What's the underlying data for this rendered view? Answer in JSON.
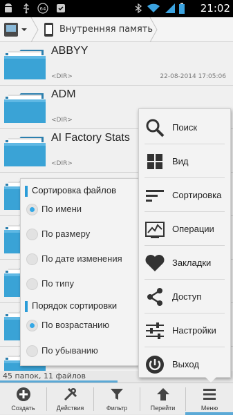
{
  "status_bar": {
    "time": "21:02",
    "icons": [
      "android-icon",
      "usb-icon",
      "notification-64-icon",
      "clean-master-icon",
      "bluetooth-icon",
      "wifi-icon",
      "signal-icon",
      "battery-icon"
    ]
  },
  "path_bar": {
    "drive_icon": "sd-card-icon",
    "location": "Внутренняя память"
  },
  "files": [
    {
      "name": "ABBYY",
      "type": "<DIR>",
      "date": "22-08-2014 17:05:06"
    },
    {
      "name": "ADM",
      "type": "<DIR>",
      "date": ""
    },
    {
      "name": "AI Factory Stats",
      "type": "<DIR>",
      "date": ""
    },
    {
      "name": "",
      "type": "",
      "date": ""
    },
    {
      "name": "",
      "type": "",
      "date": ""
    },
    {
      "name": "",
      "type": "",
      "date": ""
    },
    {
      "name": "",
      "type": "",
      "date": ""
    },
    {
      "name": "",
      "type": "",
      "date": ""
    }
  ],
  "count_text": "45 папок, 11 файлов",
  "sort_popup": {
    "section_files": "Сортировка файлов",
    "file_options": [
      {
        "label": "По имени",
        "selected": true
      },
      {
        "label": "По размеру",
        "selected": false
      },
      {
        "label": "По дате изменения",
        "selected": false
      },
      {
        "label": "По типу",
        "selected": false
      }
    ],
    "section_order": "Порядок сортировки",
    "order_options": [
      {
        "label": "По возрастанию",
        "selected": true
      },
      {
        "label": "По убыванию",
        "selected": false
      }
    ]
  },
  "menu": [
    {
      "label": "Поиск",
      "icon": "search-icon"
    },
    {
      "label": "Вид",
      "icon": "grid-view-icon"
    },
    {
      "label": "Сортировка",
      "icon": "sort-icon"
    },
    {
      "label": "Операции",
      "icon": "operations-chart-icon"
    },
    {
      "label": "Закладки",
      "icon": "heart-icon"
    },
    {
      "label": "Доступ",
      "icon": "share-icon"
    },
    {
      "label": "Настройки",
      "icon": "settings-sliders-icon"
    },
    {
      "label": "Выход",
      "icon": "power-icon"
    }
  ],
  "toolbar": [
    {
      "label": "Создать",
      "icon": "add-circle-icon"
    },
    {
      "label": "Действия",
      "icon": "tools-icon"
    },
    {
      "label": "Фильтр",
      "icon": "filter-icon"
    },
    {
      "label": "Перейти",
      "icon": "arrow-up-icon"
    },
    {
      "label": "Меню",
      "icon": "menu-icon"
    }
  ],
  "colors": {
    "accent": "#34a8e6",
    "folder": "#3aa3d6"
  }
}
